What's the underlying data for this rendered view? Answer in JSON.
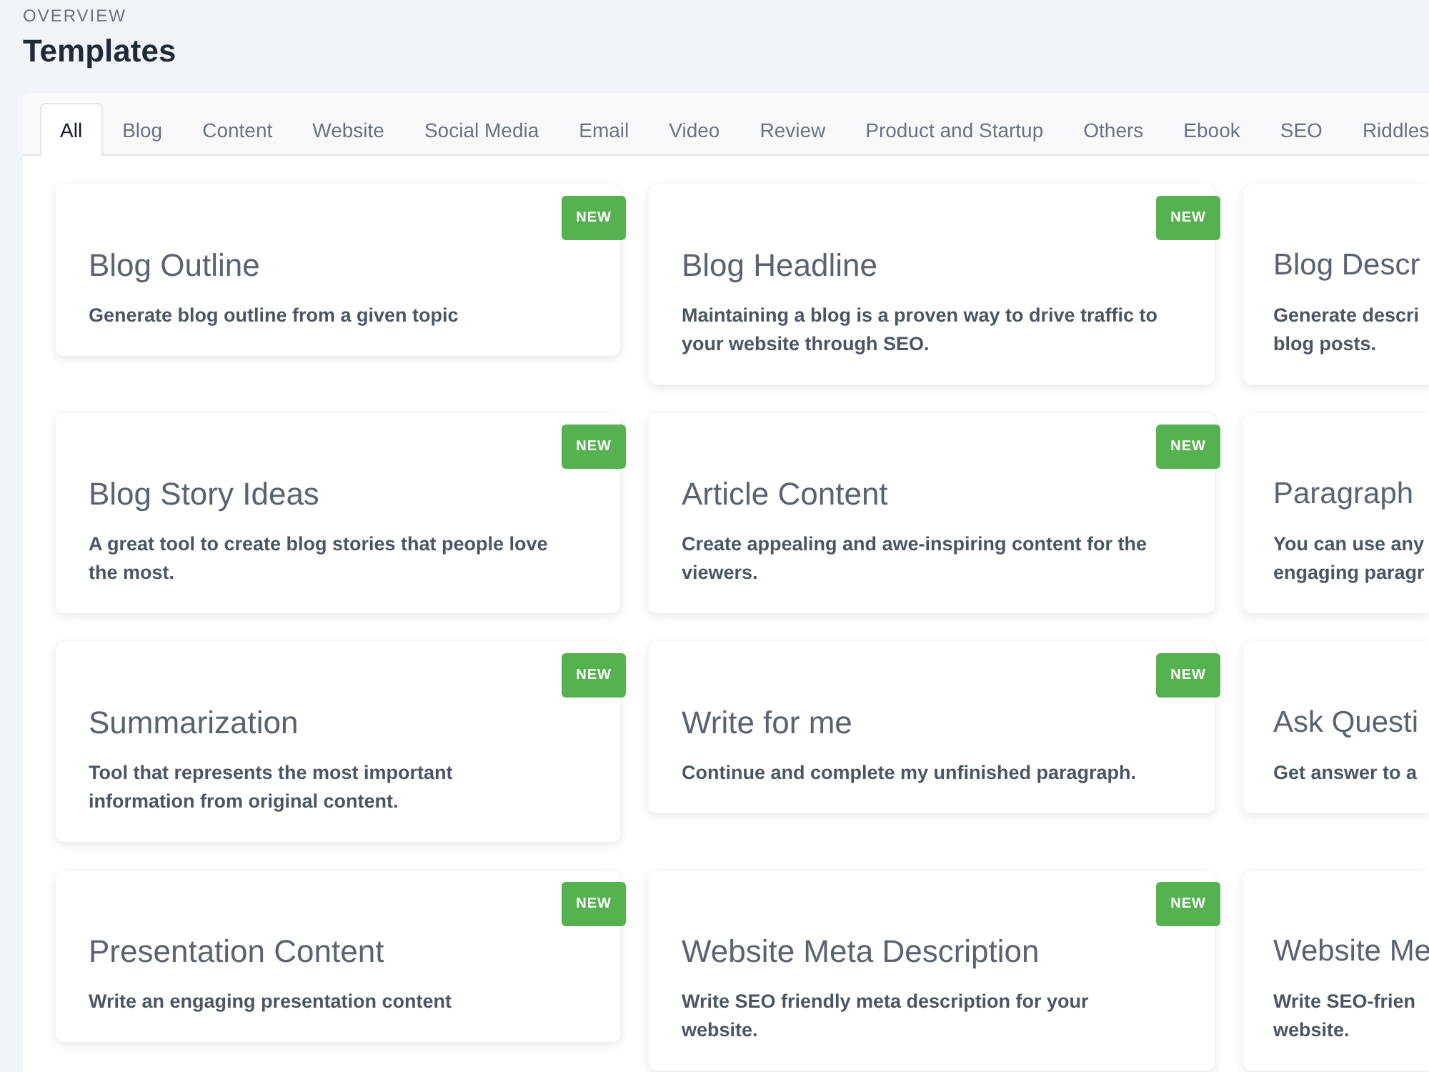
{
  "header": {
    "eyebrow": "OVERVIEW",
    "title": "Templates"
  },
  "tabs": [
    {
      "label": "All",
      "selected": true
    },
    {
      "label": "Blog",
      "selected": false
    },
    {
      "label": "Content",
      "selected": false
    },
    {
      "label": "Website",
      "selected": false
    },
    {
      "label": "Social Media",
      "selected": false
    },
    {
      "label": "Email",
      "selected": false
    },
    {
      "label": "Video",
      "selected": false
    },
    {
      "label": "Review",
      "selected": false
    },
    {
      "label": "Product and Startup",
      "selected": false
    },
    {
      "label": "Others",
      "selected": false
    },
    {
      "label": "Ebook",
      "selected": false
    },
    {
      "label": "SEO",
      "selected": false
    },
    {
      "label": "Riddles",
      "selected": false
    }
  ],
  "cards": [
    {
      "title": "Blog Outline",
      "description": "Generate blog outline from a given topic",
      "badge": "NEW"
    },
    {
      "title": "Blog Headline",
      "description": "Maintaining a blog is a proven way to drive traffic to\nyour website through SEO.",
      "badge": "NEW"
    },
    {
      "title": "Blog Descr",
      "description": "Generate descri\nblog posts."
    },
    {
      "title": "Blog Story Ideas",
      "description": "A great tool to create blog stories that people love\nthe most.",
      "badge": "NEW"
    },
    {
      "title": "Article Content",
      "description": "Create appealing and awe-inspiring content for the\nviewers.",
      "badge": "NEW"
    },
    {
      "title": "Paragraph",
      "description": "You can use any\nengaging paragr"
    },
    {
      "title": "Summarization",
      "description": "Tool that represents the most important\ninformation from original content.",
      "badge": "NEW"
    },
    {
      "title": "Write for me",
      "description": "Continue and complete my unfinished paragraph.",
      "badge": "NEW"
    },
    {
      "title": "Ask Questi",
      "description": "Get answer to a"
    },
    {
      "title": "Presentation Content",
      "description": "Write an engaging presentation content",
      "badge": "NEW"
    },
    {
      "title": "Website Meta Description",
      "description": "Write SEO friendly meta description for your\nwebsite.",
      "badge": "NEW"
    },
    {
      "title": "Website Me",
      "description": "Write SEO-frien\nwebsite."
    }
  ]
}
